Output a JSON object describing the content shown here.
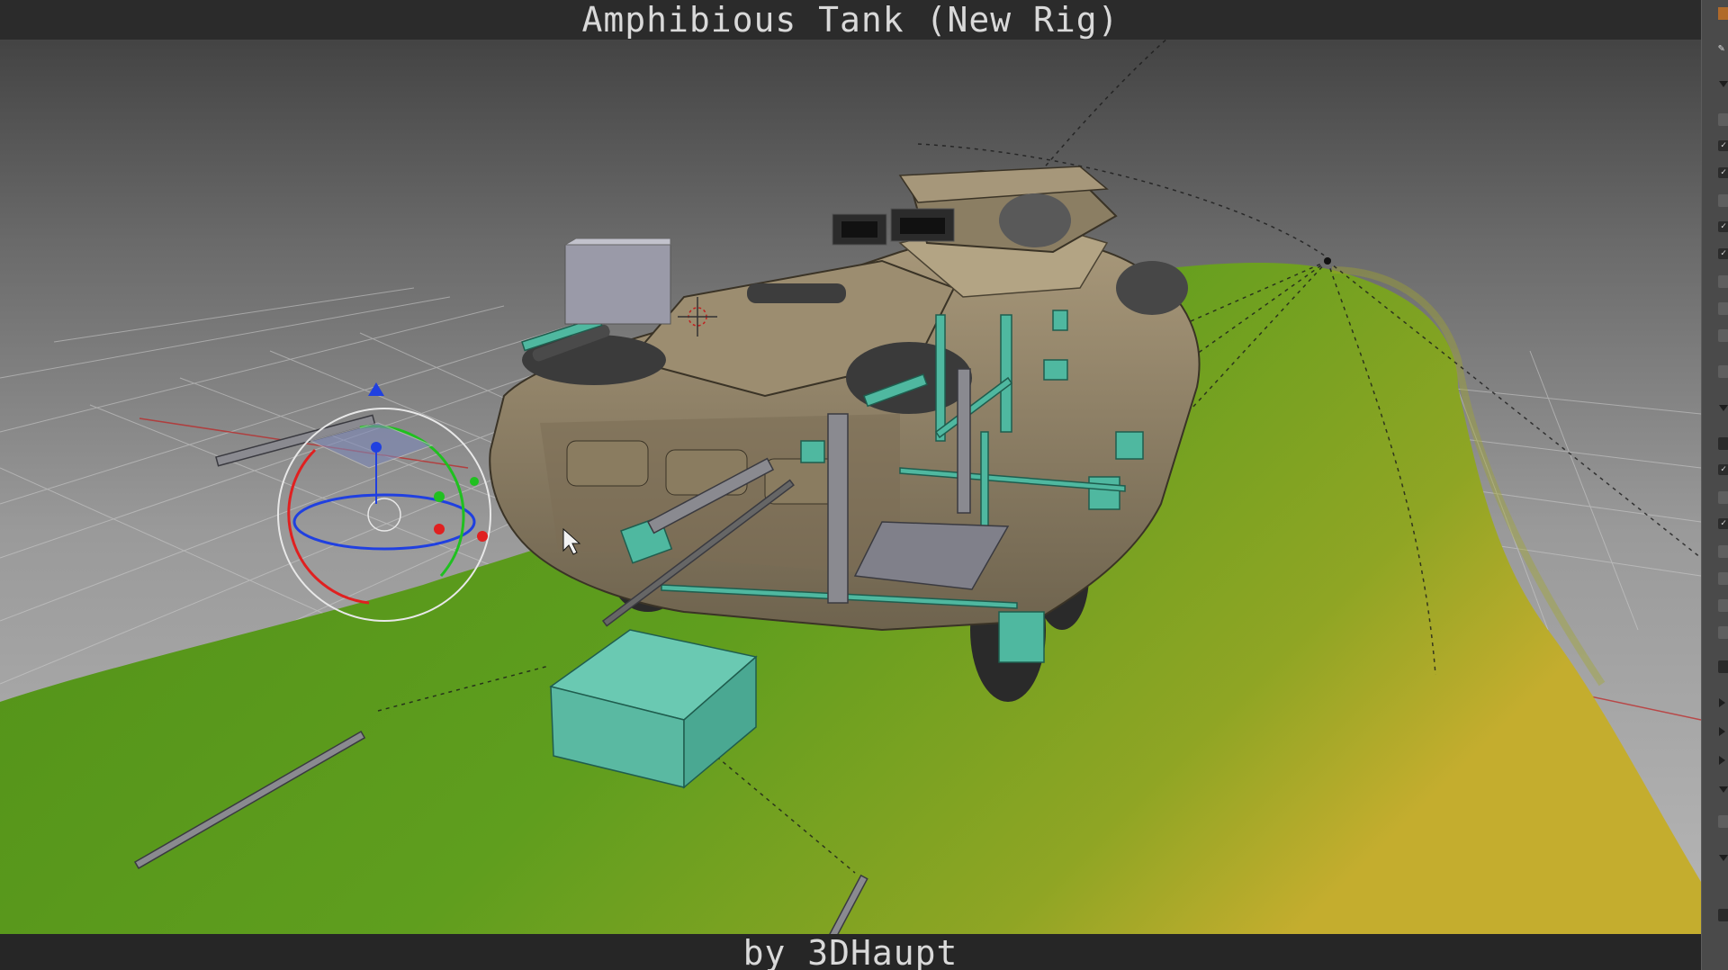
{
  "title_bar": {
    "text": "Amphibious Tank (New Rig)"
  },
  "credit_bar": {
    "text": "by 3DHaupt"
  },
  "colors": {
    "terrain_green": "#5a9a1c",
    "terrain_yellow": "#b7a82a",
    "rig_cyan": "#4fb8a0",
    "tank_body": "#8f7f62",
    "gizmo_x": "#e02020",
    "gizmo_y": "#20c020",
    "gizmo_z": "#2040e0"
  },
  "icons": {
    "mouse_cursor": "arrow-cursor-icon",
    "transform_gizmo": "rotate-gizmo-icon",
    "camera_target": "crosshair-icon"
  }
}
